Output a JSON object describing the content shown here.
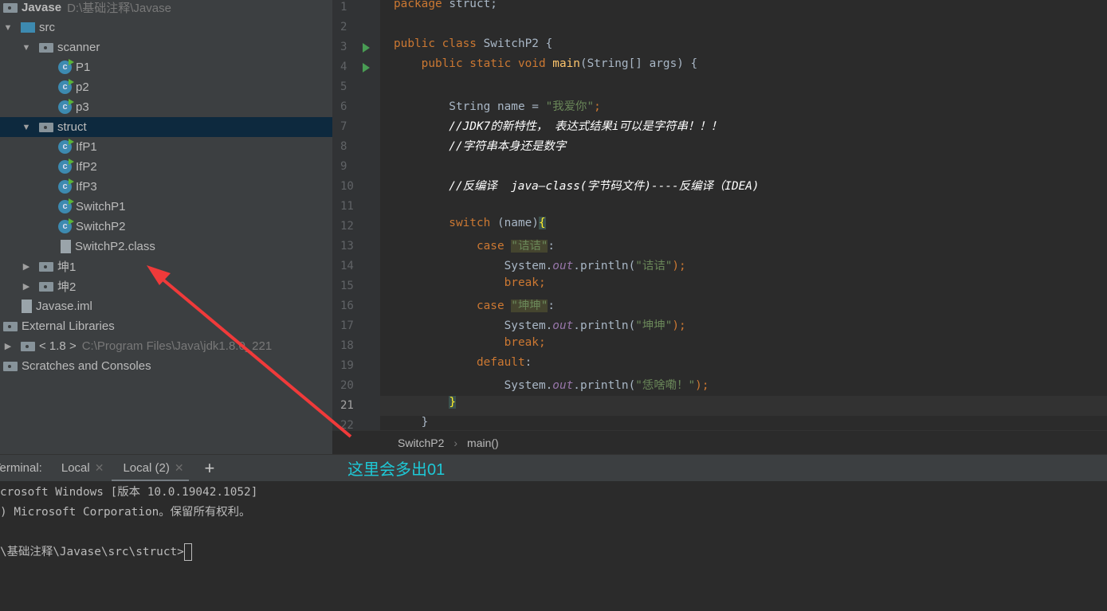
{
  "project_tree": [
    {
      "label": "Javase",
      "path": "D:\\基础注释\\Javase",
      "icon": "project-icon",
      "indent": 0,
      "toggle": "",
      "bold": true
    },
    {
      "label": "src",
      "icon": "src-folder-icon",
      "indent": 1,
      "toggle": "▼"
    },
    {
      "label": "scanner",
      "icon": "package-icon",
      "indent": 2,
      "toggle": "▼"
    },
    {
      "label": "P1",
      "icon": "class-icon",
      "indent": 3,
      "toggle": ""
    },
    {
      "label": "p2",
      "icon": "class-icon",
      "indent": 3,
      "toggle": ""
    },
    {
      "label": "p3",
      "icon": "class-icon",
      "indent": 3,
      "toggle": ""
    },
    {
      "label": "struct",
      "icon": "package-icon",
      "indent": 2,
      "toggle": "▼",
      "selected": true
    },
    {
      "label": "IfP1",
      "icon": "class-icon",
      "indent": 3,
      "toggle": ""
    },
    {
      "label": "IfP2",
      "icon": "class-icon",
      "indent": 3,
      "toggle": ""
    },
    {
      "label": "IfP3",
      "icon": "class-icon",
      "indent": 3,
      "toggle": ""
    },
    {
      "label": "SwitchP1",
      "icon": "class-icon",
      "indent": 3,
      "toggle": ""
    },
    {
      "label": "SwitchP2",
      "icon": "class-icon",
      "indent": 3,
      "toggle": ""
    },
    {
      "label": "SwitchP2.class",
      "icon": "class-file-icon",
      "indent": 3,
      "toggle": ""
    },
    {
      "label": "坤1",
      "icon": "package-icon",
      "indent": 2,
      "toggle": "▶"
    },
    {
      "label": "坤2",
      "icon": "package-icon",
      "indent": 2,
      "toggle": "▶"
    },
    {
      "label": "Javase.iml",
      "icon": "iml-file-icon",
      "indent": 1,
      "toggle": ""
    },
    {
      "label": "External Libraries",
      "icon": "libraries-icon",
      "indent": 0,
      "toggle": ""
    },
    {
      "label": "< 1.8 >",
      "path": "C:\\Program Files\\Java\\jdk1.8.0_221",
      "icon": "jdk-icon",
      "indent": 1,
      "toggle": "▶"
    },
    {
      "label": "Scratches and Consoles",
      "icon": "scratches-icon",
      "indent": 0,
      "toggle": ""
    }
  ],
  "editor": {
    "current_line": 21,
    "lines": [
      {
        "n": "1",
        "t": [
          [
            "package",
            "kw"
          ],
          [
            " struct;",
            ""
          ]
        ]
      },
      {
        "n": "2",
        "t": []
      },
      {
        "n": "3",
        "run": true,
        "t": [
          [
            "public class ",
            "kw"
          ],
          [
            "SwitchP2 {",
            ""
          ]
        ]
      },
      {
        "n": "4",
        "run": true,
        "t": [
          [
            "    public static void ",
            "kw"
          ],
          [
            "main",
            "fn"
          ],
          [
            "(String[] args) {",
            ""
          ]
        ]
      },
      {
        "n": "5",
        "t": []
      },
      {
        "n": "6",
        "t": [
          [
            "        String name = ",
            ""
          ],
          [
            "\"我爱你\"",
            "str"
          ],
          [
            ";",
            "kw"
          ]
        ]
      },
      {
        "n": "7",
        "t": [
          [
            "        //JDK7的新特性， 表达式结果i可以是字符串！！！",
            "cm"
          ]
        ]
      },
      {
        "n": "8",
        "t": [
          [
            "        //字符串本身还是数字",
            "cm"
          ]
        ]
      },
      {
        "n": "9",
        "t": []
      },
      {
        "n": "10",
        "t": [
          [
            "        //反编译  java—class(字节码文件)----反编译（IDEA)",
            "cm"
          ]
        ]
      },
      {
        "n": "11",
        "t": []
      },
      {
        "n": "12",
        "t": [
          [
            "        switch ",
            "kw"
          ],
          [
            "(name)",
            ""
          ],
          [
            "{",
            "br"
          ]
        ]
      },
      {
        "n": "13",
        "t": [
          [
            "            case ",
            "kw"
          ],
          [
            "\"诘诘\"",
            "str hl"
          ],
          [
            ":",
            ""
          ]
        ]
      },
      {
        "n": "14",
        "t": [
          [
            "                System.",
            ""
          ],
          [
            "out",
            "fld"
          ],
          [
            ".println(",
            ""
          ],
          [
            "\"诘诘\"",
            "str"
          ],
          [
            ");",
            "kw"
          ]
        ]
      },
      {
        "n": "15",
        "t": [
          [
            "                break;",
            "kw"
          ]
        ]
      },
      {
        "n": "16",
        "t": [
          [
            "            case ",
            "kw"
          ],
          [
            "\"坤坤\"",
            "str hl"
          ],
          [
            ":",
            ""
          ]
        ]
      },
      {
        "n": "17",
        "t": [
          [
            "                System.",
            ""
          ],
          [
            "out",
            "fld"
          ],
          [
            ".println(",
            ""
          ],
          [
            "\"坤坤\"",
            "str"
          ],
          [
            ");",
            "kw"
          ]
        ]
      },
      {
        "n": "18",
        "t": [
          [
            "                break;",
            "kw"
          ]
        ]
      },
      {
        "n": "19",
        "t": [
          [
            "            default",
            "kw"
          ],
          [
            ":",
            ""
          ]
        ]
      },
      {
        "n": "20",
        "t": [
          [
            "                System.",
            ""
          ],
          [
            "out",
            "fld"
          ],
          [
            ".println(",
            ""
          ],
          [
            "\"恁啥嘞！\"",
            "str"
          ],
          [
            ");",
            "kw"
          ]
        ]
      },
      {
        "n": "21",
        "t": [
          [
            "        ",
            ""
          ],
          [
            "}",
            "br"
          ]
        ]
      },
      {
        "n": "22",
        "t": [
          [
            "    }",
            ""
          ]
        ]
      }
    ]
  },
  "breadcrumb": [
    "SwitchP2",
    "main()"
  ],
  "terminal": {
    "label": "Terminal:",
    "tabs": [
      {
        "label": "Local"
      },
      {
        "label": "Local (2)",
        "active": true
      }
    ],
    "add": "+",
    "lines": [
      "crosoft Windows [版本 10.0.19042.1052]",
      ") Microsoft Corporation。保留所有权利。",
      "",
      "\\基础注释\\Javase\\src\\struct>"
    ]
  },
  "annotation": {
    "text": "这里会多出01",
    "arrow_color": "#f03a3a",
    "text_color": "#1ec8d6"
  }
}
